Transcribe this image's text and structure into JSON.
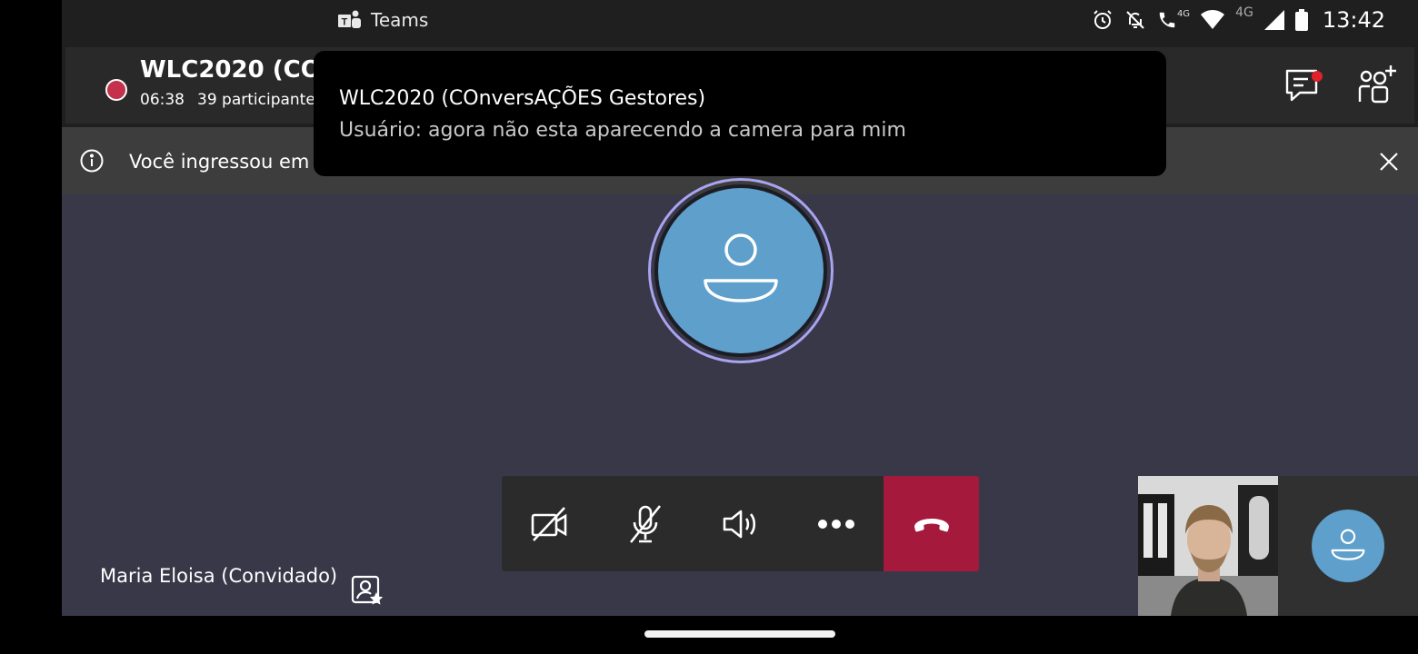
{
  "status_bar": {
    "app_name": "Teams",
    "network_label_1": "4G",
    "network_label_2": "4G",
    "time": "13:42"
  },
  "meeting": {
    "title": "WLC2020 (COn",
    "duration": "06:38",
    "participants": "39 participante",
    "recording": true
  },
  "banner": {
    "text": "Você ingressou em"
  },
  "controls": {
    "camera": "video-off-icon",
    "mic": "mic-off-icon",
    "speaker": "speaker-icon",
    "more": "more-icon",
    "hangup": "hangup-icon"
  },
  "stage": {
    "speaker_name": "Maria Eloisa (Convidado)"
  },
  "notification": {
    "title": "WLC2020 (COnversAÇÕES Gestores)",
    "body": "Usuário: agora não esta aparecendo a camera para mim"
  },
  "colors": {
    "hangup": "#a5193d",
    "avatar": "#5e9fcb",
    "stage": "#393848",
    "ring": "#a8a4f0",
    "recording": "#c4314b"
  }
}
